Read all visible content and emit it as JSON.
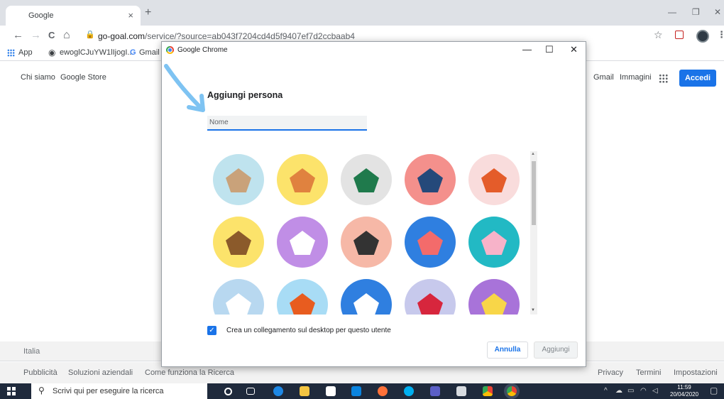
{
  "browser": {
    "tab_title": "Google",
    "tab_close": "×",
    "new_tab": "+",
    "window_minimize": "—",
    "window_restore": "❐",
    "window_close": "✕",
    "back": "←",
    "forward": "→",
    "reload": "C",
    "home": "⌂",
    "url_host": "go-goal.com",
    "url_rest": "/service/?source=ab043f7204cd4d5f9407ef7d2ccbaab4",
    "star": "☆",
    "menu": "⋮",
    "bookmarks": [
      "App",
      "ewoglCJuYW1lIjogI...",
      "Gmail"
    ]
  },
  "page": {
    "nav_left": [
      "Chi siamo",
      "Google Store"
    ],
    "gmail": "Gmail",
    "immagini": "Immagini",
    "accedi": "Accedi",
    "country": "Italia",
    "footer_left": [
      "Pubblicità",
      "Soluzioni aziendali",
      "Come funziona la Ricerca"
    ],
    "footer_right": [
      "Privacy",
      "Termini",
      "Impostazioni"
    ]
  },
  "dialog": {
    "title": "Google Chrome",
    "minimize": "—",
    "maximize": "☐",
    "close": "✕",
    "heading": "Aggiungi persona",
    "name_placeholder": "Nome",
    "checkbox_label": "Crea un collegamento sul desktop per questo utente",
    "checkbox_checked": true,
    "cancel": "Annulla",
    "add": "Aggiungi",
    "avatars": [
      {
        "icon": "cat-icon",
        "bg": "#bfe3ee",
        "fg": "#c9a27a"
      },
      {
        "icon": "corgi-icon",
        "bg": "#fce36b",
        "fg": "#e0823f"
      },
      {
        "icon": "dragon-icon",
        "bg": "#e3e3e3",
        "fg": "#1f7a4c"
      },
      {
        "icon": "elephant-icon",
        "bg": "#f4908c",
        "fg": "#25497a"
      },
      {
        "icon": "fox-icon",
        "bg": "#f9dcdc",
        "fg": "#e45c2a"
      },
      {
        "icon": "monkey-icon",
        "bg": "#fce36b",
        "fg": "#8b5a2b"
      },
      {
        "icon": "panda-icon",
        "bg": "#c08ee6",
        "fg": "#ffffff"
      },
      {
        "icon": "penguin-icon",
        "bg": "#f6b8a7",
        "fg": "#333333"
      },
      {
        "icon": "butterfly-icon",
        "bg": "#2f7fe0",
        "fg": "#f36b6b"
      },
      {
        "icon": "rabbit-icon",
        "bg": "#22b9c4",
        "fg": "#f7b3c9"
      },
      {
        "icon": "unicorn-icon",
        "bg": "#b8d8f0",
        "fg": "#ffffff"
      },
      {
        "icon": "basketball-icon",
        "bg": "#a8dcf5",
        "fg": "#e85c1f"
      },
      {
        "icon": "bicycle-icon",
        "bg": "#2f7fe0",
        "fg": "#ffffff"
      },
      {
        "icon": "bird-icon",
        "bg": "#c7c9ec",
        "fg": "#d7263d"
      },
      {
        "icon": "cheese-icon",
        "bg": "#a873d9",
        "fg": "#f8d648"
      }
    ]
  },
  "taskbar": {
    "search_placeholder": "Scrivi qui per eseguire la ricerca",
    "time": "11:59",
    "date": "20/04/2020"
  }
}
